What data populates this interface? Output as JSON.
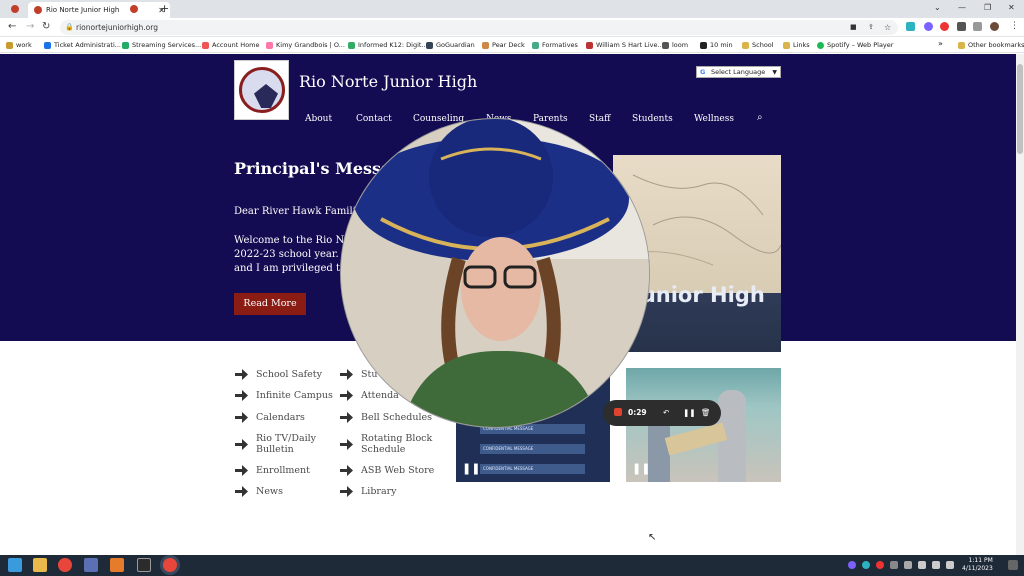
{
  "browser": {
    "tabs": [
      {
        "label": "Rio Norte Junior High",
        "active": true
      }
    ],
    "new_tab": "+",
    "url": "rionortejuniorhigh.org",
    "bookmarks": [
      "work",
      "Ticket Administrati...",
      "Streaming Services...",
      "Account Home",
      "Kimy Grandbois | O...",
      "Informed K12: Digit...",
      "GoGuardian",
      "Pear Deck",
      "Formatives",
      "William S Hart Live...",
      "loom",
      "10 min",
      "School",
      "Links",
      "Spotify – Web Player"
    ],
    "bookmarks_more": "»",
    "other_bookmarks": "Other bookmarks"
  },
  "site": {
    "name": "Rio Norte Junior High",
    "translate": "Select Language",
    "nav": [
      "About",
      "Contact",
      "Counseling",
      "News",
      "Parents",
      "Staff",
      "Students",
      "Wellness"
    ],
    "hero": {
      "title": "Principal's Messa",
      "greeting": "Dear River Hawk Famili",
      "line1": "Welcome to the Rio N",
      "line2": "2022-23 school year.",
      "line3": "and I am privileged t",
      "button": "Read More",
      "photo_sign": "Junior High"
    },
    "links_col1": [
      "School Safety",
      "Infinite Campus",
      "Calendars",
      "Rio TV/Daily\nBulletin",
      "Enrollment",
      "News"
    ],
    "links_col2": [
      "Stu",
      "Attenda",
      "Bell Schedules",
      "Rotating Block\nSchedule",
      "ASB Web Store",
      "Library"
    ],
    "messages": [
      "CONFIDENTIAL MESSAGE",
      "CONFIDENTIAL MESSAGE",
      "CONFIDENTIAL MESSAGE"
    ]
  },
  "recorder": {
    "time": "0:29"
  },
  "taskbar": {
    "time": "1:11 PM",
    "date": "4/11/2023"
  },
  "colors": {
    "hero_bg": "#130c52",
    "button_bg": "#8a1c14",
    "record_red": "#e0432f"
  }
}
